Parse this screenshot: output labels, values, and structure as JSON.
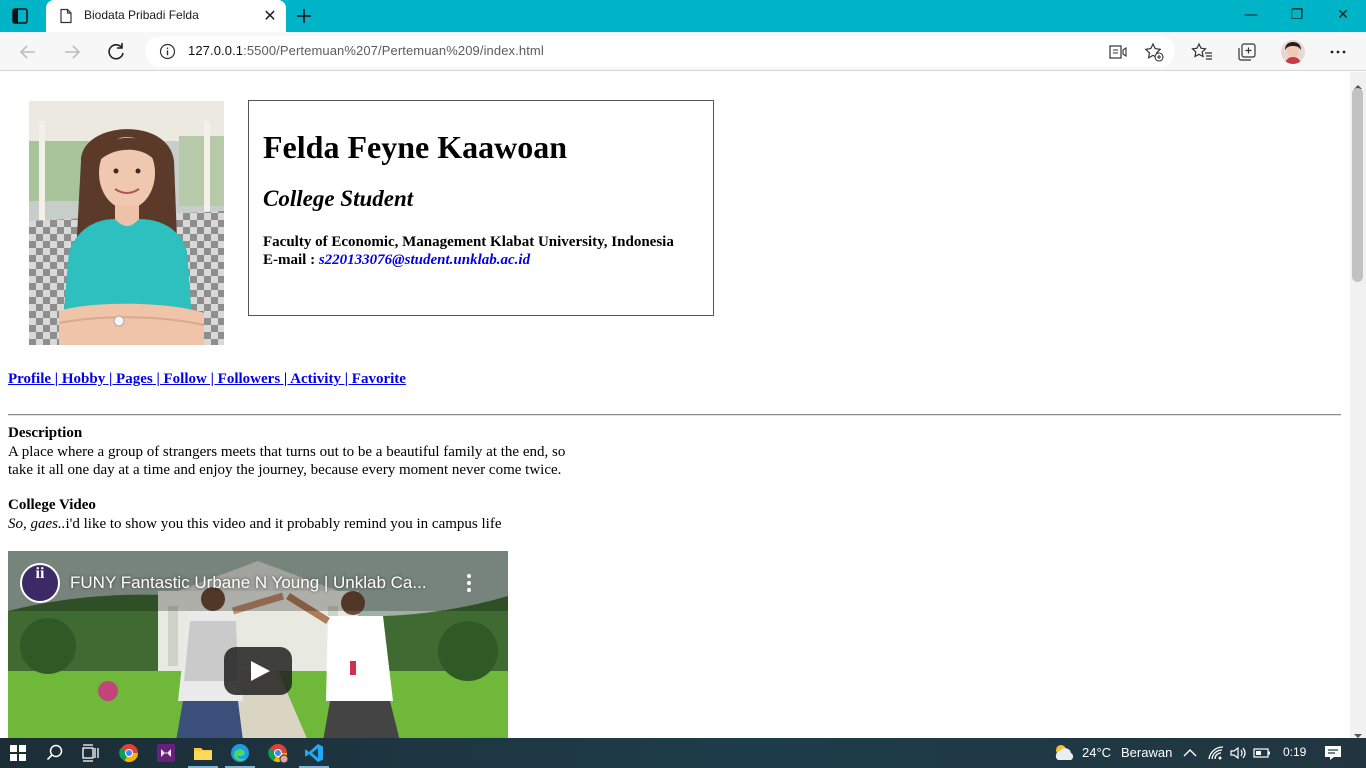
{
  "browser": {
    "tab_title": "Biodata Pribadi Felda",
    "tab_close": "✕",
    "url_host": "127.0.0.1",
    "url_path": ":5500/Pertemuan%207/Pertemuan%209/index.html",
    "window_minimize": "—",
    "window_restore": "❐",
    "window_close": "✕"
  },
  "page": {
    "name": "Felda Feyne Kaawoan",
    "role": "College Student",
    "faculty": "Faculty of Economic, Management Klabat University, Indonesia",
    "email_label": "E-mail :",
    "email": "s220133076@student.unklab.ac.id",
    "nav": [
      {
        "label": "Profile"
      },
      {
        "label": " | "
      },
      {
        "label": " Hobby"
      },
      {
        "label": " | "
      },
      {
        "label": " Pages"
      },
      {
        "label": " | "
      },
      {
        "label": " Follow"
      },
      {
        "label": " | "
      },
      {
        "label": " Followers"
      },
      {
        "label": " | "
      },
      {
        "label": " Activity"
      },
      {
        "label": " | "
      },
      {
        "label": " Favorite"
      }
    ],
    "description_title": "Description",
    "description_line1": "A place where a group of strangers meets that turns out to be a beautiful family at the end, so",
    "description_line2": "take it all one day at a time and enjoy the journey, because every moment never come twice.",
    "video_section_title": "College Video",
    "video_intro_italic": "So, gaes..",
    "video_intro_rest": "i'd like to show you this video and it probably remind you in campus life",
    "video_title": "FUNY Fantastic Urbane N Young | Unklab Ca...",
    "video_channel_initials": "ii"
  },
  "taskbar": {
    "weather_temp": "24°C",
    "weather_text": "Berawan",
    "clock": "0:19"
  },
  "colors": {
    "tabbar": "#00b4c8",
    "link": "#0000ee",
    "taskbar": "#1e3d4a"
  }
}
